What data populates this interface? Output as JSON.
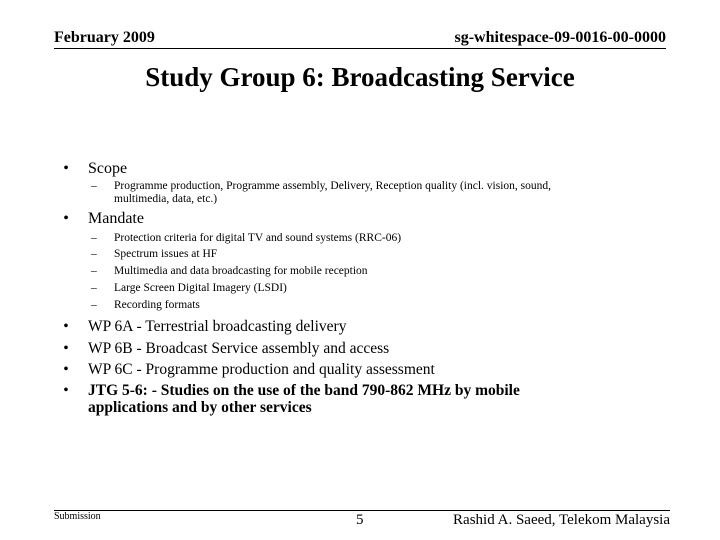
{
  "header": {
    "date": "February 2009",
    "document_id": "sg-whitespace-09-0016-00-0000"
  },
  "title": "Study Group 6: Broadcasting Service",
  "body": {
    "bullet_glyph": "•",
    "dash_glyph": "–",
    "scope": {
      "label": "Scope",
      "items": [
        {
          "line1": "Programme production, Programme assembly, Delivery, Reception quality (incl. vision, sound,",
          "line2": "multimedia, data, etc.)"
        }
      ]
    },
    "mandate": {
      "label": "Mandate",
      "items": [
        "Protection criteria for digital TV and sound systems (RRC-06)",
        "Spectrum issues at HF",
        "Multimedia and data broadcasting for mobile reception",
        "Large Screen Digital Imagery (LSDI)",
        "Recording formats"
      ]
    },
    "working_parties": [
      "WP 6A - Terrestrial broadcasting delivery",
      "WP 6B - Broadcast Service assembly and access",
      "WP 6C - Programme production and quality assessment"
    ],
    "jtg": {
      "line1": "JTG 5-6: - Studies on the use of the band 790-862 MHz by mobile",
      "line2": "applications and by other services"
    }
  },
  "footer": {
    "left": "Submission",
    "page_number": "5",
    "author": "Rashid A. Saeed, Telekom Malaysia"
  }
}
